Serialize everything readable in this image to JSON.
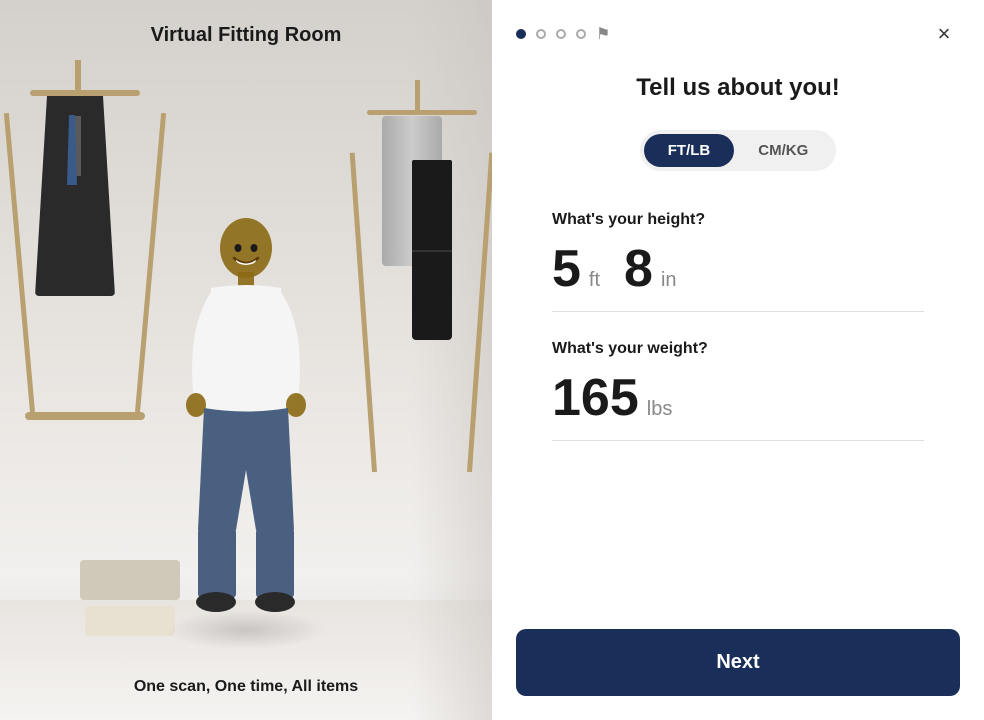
{
  "left": {
    "title": "Virtual Fitting Room",
    "subtitle": "One scan, One time, All items"
  },
  "right": {
    "close_label": "×",
    "form_title": "Tell us about you!",
    "unit_ft_lb": "FT/LB",
    "unit_cm_kg": "CM/KG",
    "active_unit": "FT/LB",
    "height_label": "What's your height?",
    "height_feet": "5",
    "height_feet_unit": "ft",
    "height_inches": "8",
    "height_inches_unit": "in",
    "weight_label": "What's your weight?",
    "weight_value": "165",
    "weight_unit": "lbs",
    "next_button": "Next"
  },
  "pagination": {
    "dots": [
      {
        "type": "filled"
      },
      {
        "type": "empty"
      },
      {
        "type": "empty"
      },
      {
        "type": "empty"
      },
      {
        "type": "flag"
      }
    ]
  },
  "colors": {
    "primary": "#1a2e5a",
    "text": "#1a1a1a",
    "muted": "#888888",
    "divider": "#e0e0e0"
  }
}
